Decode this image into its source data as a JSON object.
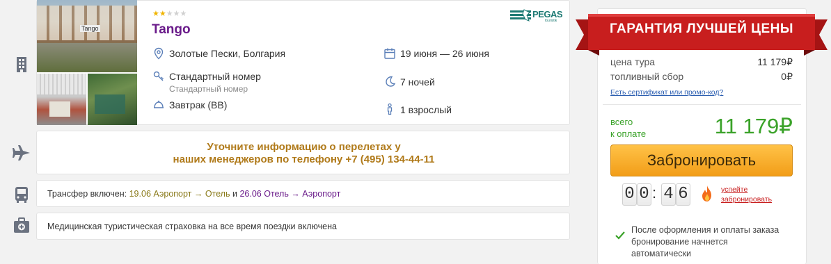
{
  "hotel": {
    "stars_filled": 2,
    "stars_total": 5,
    "name": "Tango",
    "operator_logo": "PEGAS",
    "operator_logo_small": "touristik",
    "location": "Золотые Пески, Болгария",
    "room": "Стандартный номер",
    "room_sub": "Стандартный номер",
    "meal": "Завтрак (BB)",
    "dates": "19 июня — 26 июня",
    "nights": "7 ночей",
    "guests": "1 взрослый",
    "photo_sign": "Tango"
  },
  "flight": {
    "line1": "Уточните информацию о перелетах у",
    "line2": "наших менеджеров по телефону +7 (495) 134-44-11"
  },
  "transfer": {
    "prefix": "Трансфер включен: ",
    "seg1_date": "19.06",
    "seg1_route": "Аэропорт → Отель",
    "joiner": " и ",
    "seg2_date": "26.06",
    "seg2_route": "Отель → Аэропорт"
  },
  "insurance": {
    "text": "Медицинская туристическая страховка на все время поездки включена"
  },
  "price": {
    "banner": "ГАРАНТИЯ ЛУЧШЕЙ ЦЕНЫ",
    "tour_label": "цена тура",
    "tour_value": "11 179₽",
    "fuel_label": "топливный сбор",
    "fuel_value": "0₽",
    "promo_link": "Есть сертификат или промо-код?",
    "total_label_1": "всего",
    "total_label_2": "к оплате",
    "total_value": "11 179₽",
    "book_button": "Забронировать",
    "timer_d1": "0",
    "timer_d2": "0",
    "timer_colon": ":",
    "timer_d3": "4",
    "timer_d4": "6",
    "hurry_1": "успейте",
    "hurry_2": "забронировать",
    "note_1": "После оформления и оплаты заказа",
    "note_2": "бронирование начнется",
    "note_3": "автоматически"
  },
  "colors": {
    "accent_purple": "#6a1b8a",
    "flight_text": "#b07a1a",
    "price_green": "#3aa229",
    "banner_red": "#c81e1e",
    "button_orange": "#f5a623",
    "link_blue": "#2a5db0"
  },
  "icons": [
    "building-icon",
    "plane-icon",
    "bus-icon",
    "medkit-icon",
    "pin-icon",
    "key-icon",
    "tray-icon",
    "calendar-icon",
    "moon-icon",
    "person-icon",
    "flame-icon",
    "check-icon"
  ]
}
